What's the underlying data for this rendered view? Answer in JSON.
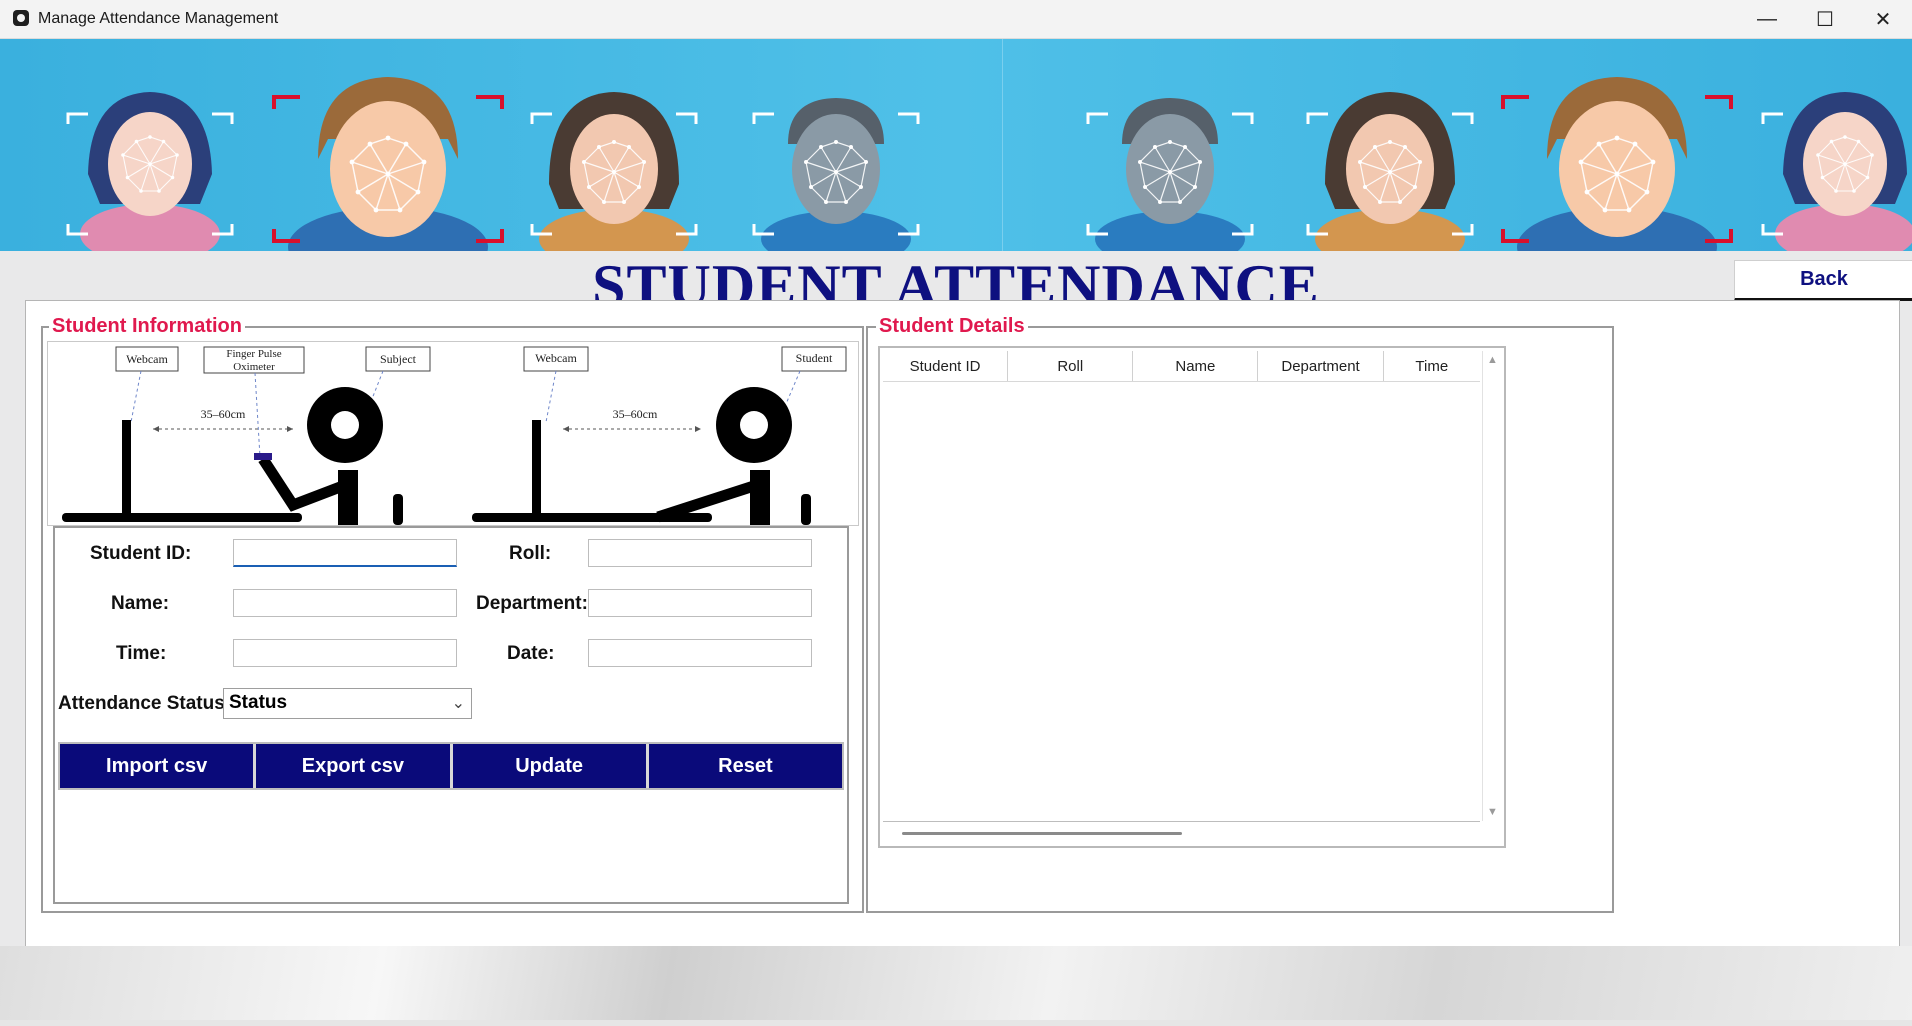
{
  "window": {
    "title": "Manage Attendance Management",
    "controls": [
      "—",
      "☐",
      "✕"
    ]
  },
  "header": {
    "title": "STUDENT ATTENDANCE",
    "back_label": "Back"
  },
  "student_info": {
    "group_title": "Student Information",
    "diagram": {
      "left": {
        "labels": [
          "Webcam",
          "Finger Pulse",
          "Oximeter",
          "Subject"
        ],
        "distance": "35–60cm"
      },
      "right": {
        "labels": [
          "Webcam",
          "Student"
        ],
        "distance": "35–60cm"
      }
    },
    "fields": {
      "student_id": {
        "label": "Student ID:",
        "value": ""
      },
      "roll": {
        "label": "Roll:",
        "value": ""
      },
      "name": {
        "label": "Name:",
        "value": ""
      },
      "department": {
        "label": "Department:",
        "value": ""
      },
      "time": {
        "label": "Time:",
        "value": ""
      },
      "date": {
        "label": "Date:",
        "value": ""
      }
    },
    "attendance_status": {
      "label": "Attendance Status",
      "selected": "Status"
    },
    "buttons": {
      "import": "Import csv",
      "export": "Export csv",
      "update": "Update",
      "reset": "Reset"
    }
  },
  "student_details": {
    "group_title": "Student Details",
    "columns": [
      "Student ID",
      "Roll",
      "Name",
      "Department",
      "Time"
    ],
    "rows": []
  },
  "colors": {
    "accent_title": "#0e1080",
    "group_title": "#e0194e",
    "button_bg": "#0a0a7a",
    "banner": "#3ab0de"
  }
}
